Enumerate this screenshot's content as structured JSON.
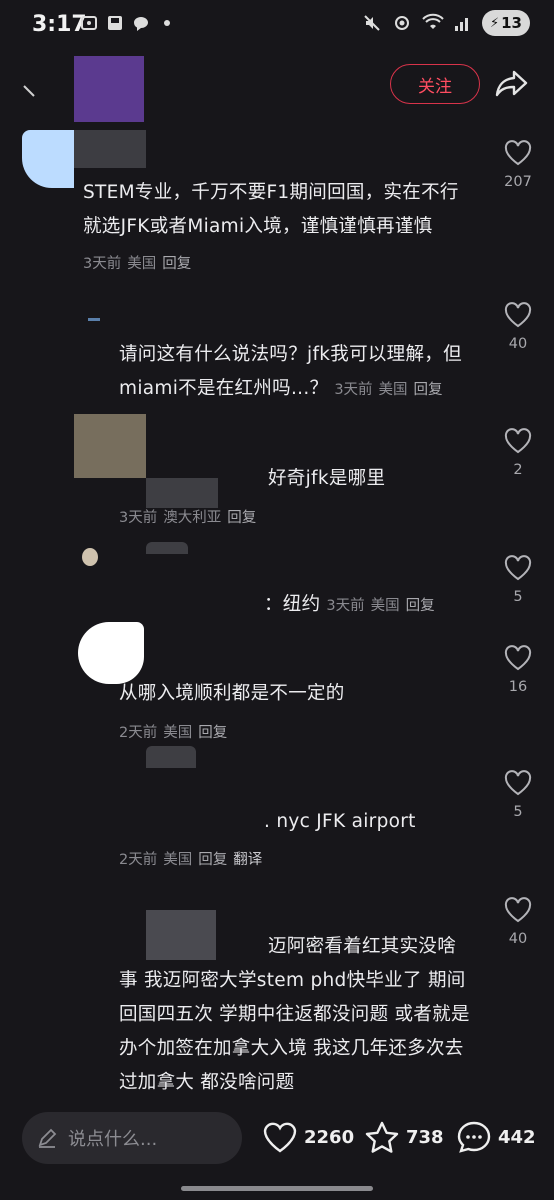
{
  "status_bar": {
    "time": "3:17",
    "battery": "13",
    "icons": [
      "gallery-icon",
      "save-icon",
      "chat-bubble-icon",
      "dot-icon",
      "mute-icon",
      "hotspot-icon",
      "wifi-icon",
      "signal-icon"
    ]
  },
  "header": {
    "follow_label": "关注",
    "share_icon": "share-icon"
  },
  "comments": [
    {
      "text_lines": [
        "STEM专业，千万不要F1期间回国，实在不行",
        "就选JFK或者Miami入境，谨慎谨慎再谨慎"
      ],
      "time": "3天前",
      "location": "美国",
      "reply": "回复",
      "likes": "207"
    },
    {
      "text_lines": [
        "请问这有什么说法吗？jfk我可以理解，但",
        "miami不是在红州吗...？"
      ],
      "time": "3天前",
      "location": "美国",
      "reply": "回复",
      "likes": "40"
    },
    {
      "text_lines": [
        "好奇jfk是哪里"
      ],
      "time": "3天前",
      "location": "澳大利亚",
      "reply": "回复",
      "likes": "2"
    },
    {
      "text_lines": [
        "：纽约"
      ],
      "time": "3天前",
      "location": "美国",
      "reply": "回复",
      "likes": "5"
    },
    {
      "text_lines": [
        "从哪入境顺利都是不一定的"
      ],
      "time": "2天前",
      "location": "美国",
      "reply": "回复",
      "likes": "16"
    },
    {
      "text_lines": [
        ". nyc JFK airport"
      ],
      "time": "2天前",
      "location": "美国",
      "reply": "回复",
      "translate": "翻译",
      "likes": "5"
    },
    {
      "text_lines": [
        "迈阿密看着红其实没啥",
        "事 我迈阿密大学stem phd快毕业了 期间",
        "回国四五次 学期中往返都没问题 或者就是",
        "办个加签在加拿大入境 我这几年还多次去",
        "过加拿大 都没啥问题"
      ],
      "likes": "40"
    }
  ],
  "bottom_bar": {
    "input_placeholder": "说点什么...",
    "like_count": "2260",
    "star_count": "738",
    "comment_count": "442"
  }
}
